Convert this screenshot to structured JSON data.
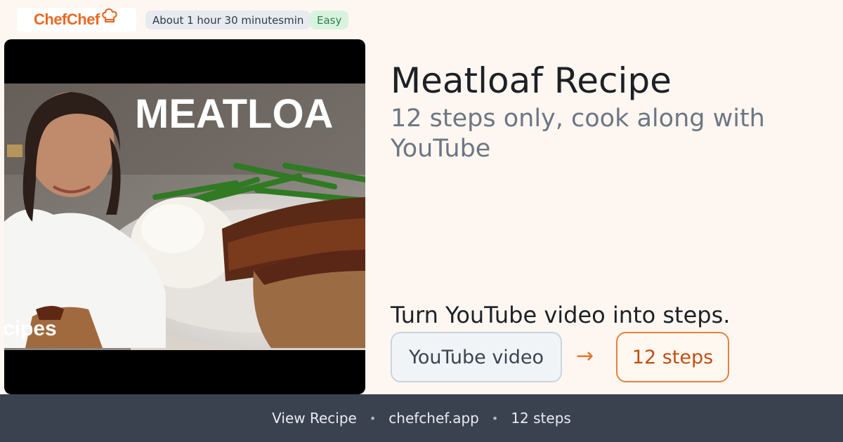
{
  "brand": {
    "name": "ChefChef",
    "color": "#e86a24",
    "icon": "chef-hat-icon"
  },
  "meta": {
    "time": "About 1 hour 30 minutesmin",
    "difficulty": "Easy"
  },
  "thumbnail": {
    "overlay_text": "MEATLOA",
    "corner_text": "cipes",
    "play_icon": "video-thumbnail"
  },
  "recipe": {
    "title": "Meatloaf Recipe",
    "subtitle": "12 steps only, cook along with YouTube"
  },
  "conversion": {
    "tagline": "Turn YouTube video into steps.",
    "source_label": "YouTube video",
    "arrow": "→",
    "target_label": "12 steps",
    "accent_color": "#e9803b"
  },
  "footer": {
    "items": [
      "View Recipe",
      "chefchef.app",
      "12 steps"
    ],
    "separator": "•"
  }
}
